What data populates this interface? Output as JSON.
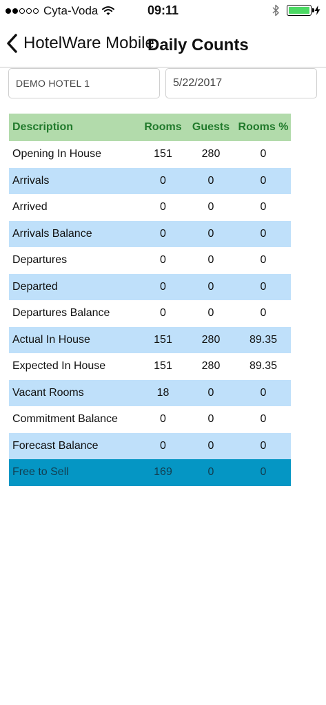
{
  "status_bar": {
    "carrier": "Cyta-Voda",
    "time": "09:11",
    "signal_bars": 2,
    "signal_total": 5,
    "battery_level": 1.0,
    "battery_color": "#4cd964"
  },
  "nav": {
    "back_label": "HotelWare Mobile",
    "title": "Daily Counts"
  },
  "filters": {
    "hotel": "DEMO HOTEL 1",
    "date": "5/22/2017"
  },
  "table": {
    "headers": {
      "description": "Description",
      "rooms": "Rooms",
      "guests": "Guests",
      "rooms_pct": "Rooms %"
    },
    "rows": [
      {
        "description": "Opening In House",
        "rooms": "151",
        "guests": "280",
        "rooms_pct": "0"
      },
      {
        "description": "Arrivals",
        "rooms": "0",
        "guests": "0",
        "rooms_pct": "0"
      },
      {
        "description": "Arrived",
        "rooms": "0",
        "guests": "0",
        "rooms_pct": "0"
      },
      {
        "description": "Arrivals Balance",
        "rooms": "0",
        "guests": "0",
        "rooms_pct": "0"
      },
      {
        "description": "Departures",
        "rooms": "0",
        "guests": "0",
        "rooms_pct": "0"
      },
      {
        "description": "Departed",
        "rooms": "0",
        "guests": "0",
        "rooms_pct": "0"
      },
      {
        "description": "Departures Balance",
        "rooms": "0",
        "guests": "0",
        "rooms_pct": "0"
      },
      {
        "description": "Actual In House",
        "rooms": "151",
        "guests": "280",
        "rooms_pct": "89.35"
      },
      {
        "description": "Expected In House",
        "rooms": "151",
        "guests": "280",
        "rooms_pct": "89.35"
      },
      {
        "description": "Vacant Rooms",
        "rooms": "18",
        "guests": "0",
        "rooms_pct": "0"
      },
      {
        "description": "Commitment Balance",
        "rooms": "0",
        "guests": "0",
        "rooms_pct": "0"
      },
      {
        "description": "Forecast Balance",
        "rooms": "0",
        "guests": "0",
        "rooms_pct": "0"
      },
      {
        "description": "Free to Sell",
        "rooms": "169",
        "guests": "0",
        "rooms_pct": "0"
      }
    ]
  },
  "colors": {
    "header_bg": "#b2dbab",
    "header_text": "#217a2c",
    "alt_row_bg": "#bfe0fa",
    "highlight_row_bg": "#0596c4"
  }
}
